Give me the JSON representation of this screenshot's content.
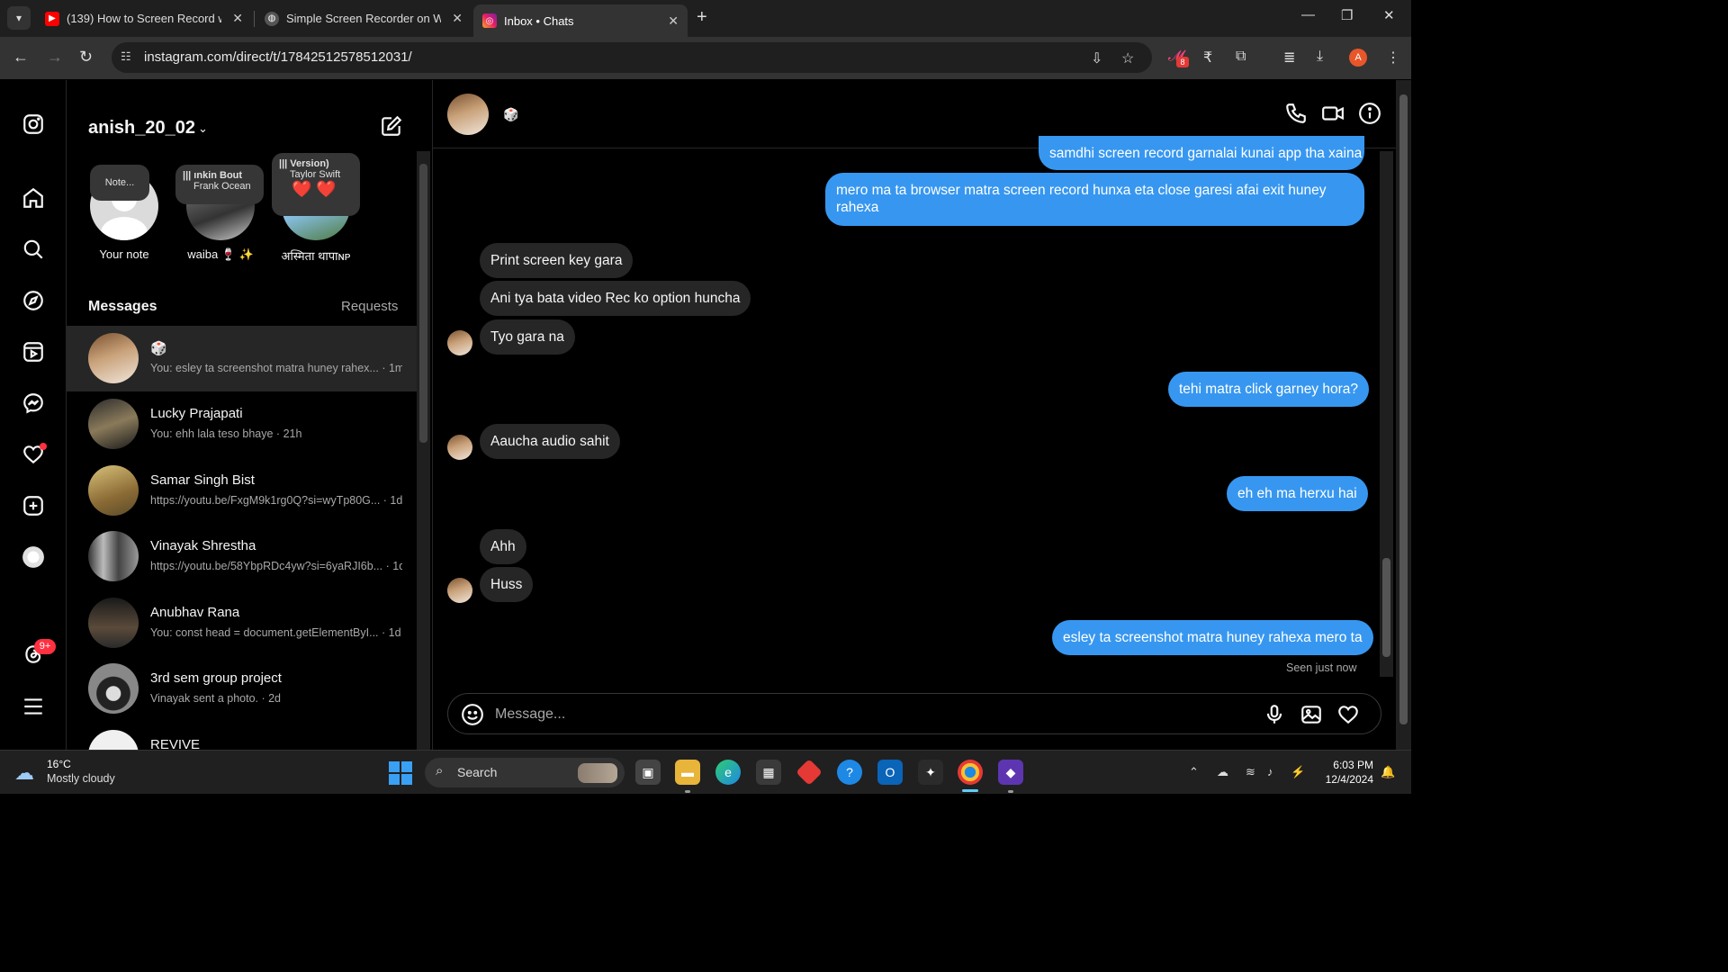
{
  "browser": {
    "tabs": [
      {
        "title": "(139) How to Screen Record wit",
        "favicon": "youtube-icon",
        "active": false
      },
      {
        "title": "Simple Screen Recorder on Win",
        "favicon": "globe-icon",
        "active": false
      },
      {
        "title": "Inbox • Chats",
        "favicon": "instagram-icon",
        "active": true
      }
    ],
    "url": "instagram.com/direct/t/17842512578512031/",
    "extension_badge": "8",
    "profile_initial": "A"
  },
  "rail": {
    "items": [
      "instagram-icon",
      "home-icon",
      "search-icon",
      "explore-icon",
      "reels-icon",
      "messenger-icon",
      "heart-icon",
      "create-icon",
      "profile-icon",
      "threads-icon",
      "menu-icon"
    ],
    "threads_badge": "9+"
  },
  "inbox": {
    "username": "anish_20_02",
    "notes": [
      {
        "name": "Your note",
        "bubble": "Note..."
      },
      {
        "name": "waiba 🍷 ✨",
        "bubble_song": "ınkin Bout",
        "bubble_artist": "Frank Ocean"
      },
      {
        "name": "अस्मिता थापाɴᴘ",
        "bubble_song": "Version)",
        "bubble_artist": "Taylor Swift",
        "bubble_emoji": "❤️ ❤️"
      }
    ],
    "messages_label": "Messages",
    "requests_label": "Requests",
    "threads": [
      {
        "name": "🎲",
        "preview": "You: esley ta screenshot matra huney rahex... · 1m",
        "selected": true
      },
      {
        "name": "Lucky Prajapati",
        "preview": "You: ehh lala teso bhaye · 21h"
      },
      {
        "name": "Samar Singh Bist",
        "preview": "https://youtu.be/FxgM9k1rg0Q?si=wyTp80G... · 1d"
      },
      {
        "name": "Vinayak Shrestha",
        "preview": "https://youtu.be/58YbpRDc4yw?si=6yaRJI6b... · 1d"
      },
      {
        "name": "Anubhav Rana",
        "preview": "You: const head = document.getElementByI... · 1d"
      },
      {
        "name": "3rd sem group project",
        "preview": "Vinayak sent a photo. · 2d"
      },
      {
        "name": "REVIVE",
        "preview": ""
      }
    ]
  },
  "chat": {
    "header_name": "🎲",
    "messages": [
      {
        "from": "me",
        "text": "samdhi screen record garnalai kunai app tha xaina"
      },
      {
        "from": "me",
        "text": "mero ma ta browser matra screen record hunxa eta close garesi afai exit huney",
        "text2": "rahexa"
      },
      {
        "from": "them",
        "text": "Print screen key gara"
      },
      {
        "from": "them",
        "text": "Ani tya bata video Rec ko option huncha"
      },
      {
        "from": "them",
        "text": "Tyo gara na"
      },
      {
        "from": "me",
        "text": "tehi matra click garney hora?"
      },
      {
        "from": "them",
        "text": "Aaucha audio sahit"
      },
      {
        "from": "me",
        "text": "eh eh ma herxu hai"
      },
      {
        "from": "them",
        "text": "Ahh"
      },
      {
        "from": "them",
        "text": "Huss"
      },
      {
        "from": "me",
        "text": "esley ta screenshot matra huney rahexa mero ta"
      }
    ],
    "seen": "Seen just now",
    "composer_placeholder": "Message..."
  },
  "taskbar": {
    "temperature": "16°C",
    "condition": "Mostly cloudy",
    "search_label": "Search",
    "time": "6:03 PM",
    "date": "12/4/2024"
  },
  "colors": {
    "accent_blue": "#3797f0",
    "incoming_bubble": "#262626",
    "notification_red": "#ff3040"
  }
}
